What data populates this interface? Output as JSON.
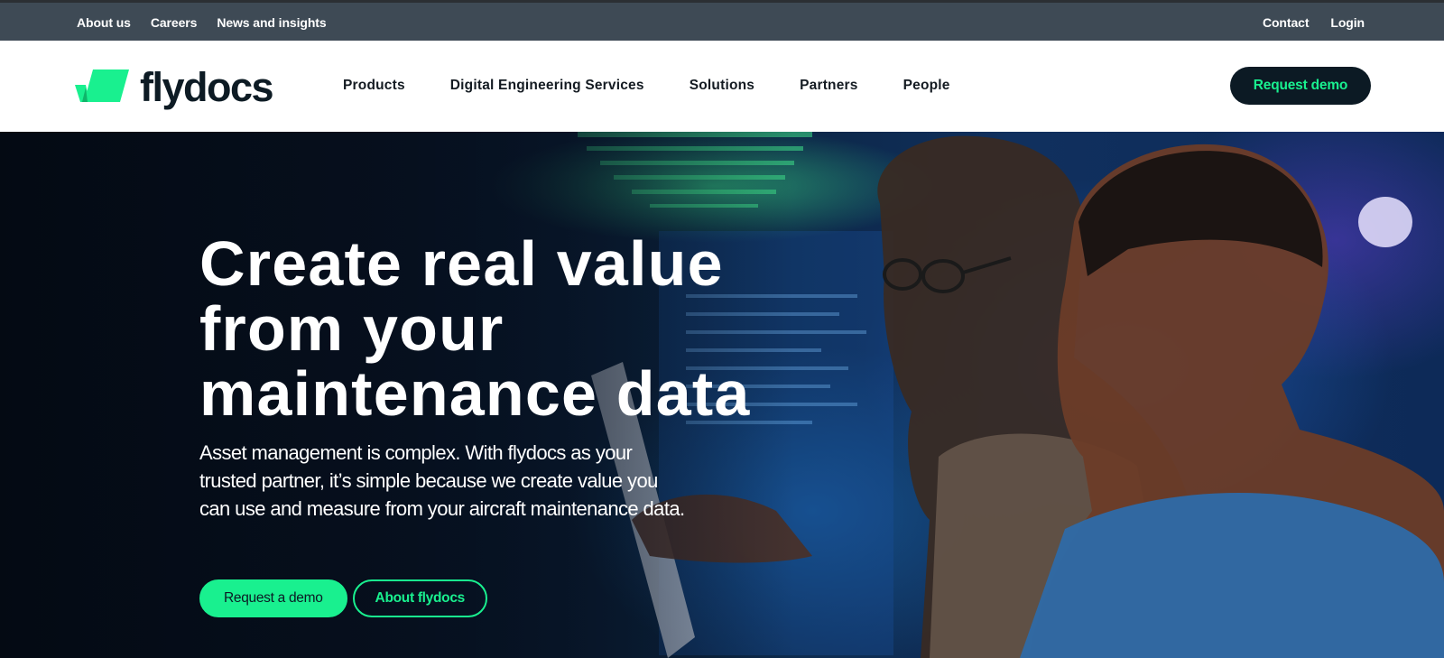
{
  "utility_bar": {
    "left_links": [
      "About us",
      "Careers",
      "News and insights"
    ],
    "right_links": [
      "Contact",
      "Login"
    ]
  },
  "brand": {
    "logo_text": "flydocs",
    "accent": "#19f08f",
    "dark": "#0c1a24"
  },
  "nav": {
    "items": [
      "Products",
      "Digital Engineering Services",
      "Solutions",
      "Partners",
      "People"
    ],
    "cta_label": "Request demo"
  },
  "hero": {
    "title_lines": [
      "Create real value",
      "from your",
      "maintenance data"
    ],
    "subtitle": "Asset management is complex. With flydocs as your trusted partner, it’s simple because we create value you can use and measure from your aircraft maintenance data.",
    "primary_button": "Request a demo",
    "secondary_button": "About flydocs"
  }
}
